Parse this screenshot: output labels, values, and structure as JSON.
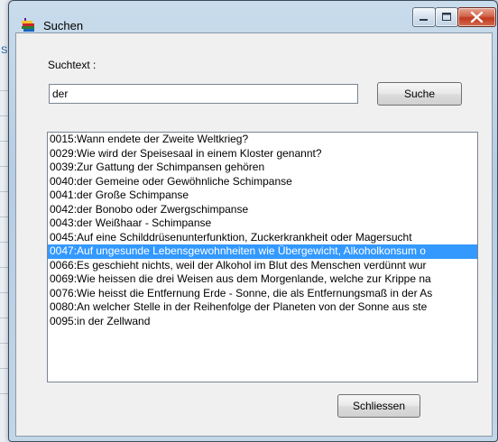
{
  "background_app": {
    "partial_text": "Si"
  },
  "window": {
    "title": "Suchen",
    "icon": "books-icon"
  },
  "search": {
    "label": "Suchtext :",
    "value": "der",
    "button_label": "Suche"
  },
  "results": {
    "selected_index": 8,
    "items": [
      "0015:Wann endete der Zweite Weltkrieg?",
      "0029:Wie wird der Speisesaal in einem Kloster genannt?",
      "0039:Zur Gattung der Schimpansen gehören",
      "0040:der Gemeine oder Gewöhnliche Schimpanse",
      "0041:der Große Schimpanse",
      "0042:der Bonobo oder Zwergschimpanse",
      "0043:der Weißhaar - Schimpanse",
      "0045:Auf eine Schilddrüsenunterfunktion, Zuckerkrankheit oder Magersucht",
      "0047:Auf ungesunde Lebensgewohnheiten wie Übergewicht, Alkoholkonsum o",
      "0066:Es geschieht nichts, weil der Alkohol im Blut des Menschen verdünnt wur",
      "0069:Wie heissen die drei Weisen aus dem Morgenlande, welche zur Krippe na",
      "0076:Wie heisst die Entfernung Erde - Sonne, die als Entfernungsmaß in der As",
      "0080:An welcher Stelle in der Reihenfolge der Planeten von der Sonne aus ste",
      "0095:in der Zellwand"
    ]
  },
  "footer": {
    "close_label": "Schliessen"
  },
  "colors": {
    "selection": "#3399ff",
    "close_button": "#c0391f"
  }
}
